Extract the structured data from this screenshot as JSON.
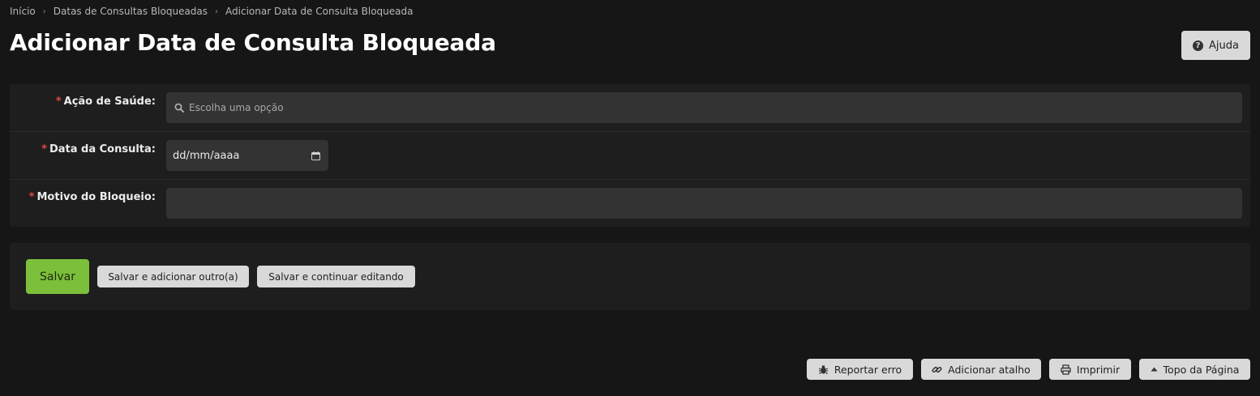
{
  "breadcrumb": {
    "items": [
      "Início",
      "Datas de Consultas Bloqueadas",
      "Adicionar Data de Consulta Bloqueada"
    ],
    "separator": "›"
  },
  "header": {
    "title": "Adicionar Data de Consulta Bloqueada",
    "help_label": "Ajuda",
    "help_icon": "question-circle-icon"
  },
  "form": {
    "required_marker": "*",
    "acao_saude": {
      "label": "Ação de Saúde:",
      "placeholder": "Escolha uma opção",
      "icon": "search-icon"
    },
    "data_consulta": {
      "label": "Data da Consulta:",
      "value": "dd/mm/aaaa",
      "icon": "calendar-icon"
    },
    "motivo_bloqueio": {
      "label": "Motivo do Bloqueio:",
      "value": ""
    }
  },
  "actions": {
    "save": "Salvar",
    "save_add_another": "Salvar e adicionar outro(a)",
    "save_continue": "Salvar e continuar editando"
  },
  "footer": {
    "report_error": "Reportar erro",
    "add_shortcut": "Adicionar atalho",
    "print": "Imprimir",
    "top_of_page": "Topo da Página"
  },
  "colors": {
    "background": "#161616",
    "panel": "#1e1e1e",
    "input": "#333333",
    "accent_green": "#7bbf3a",
    "required_red": "#e04848",
    "button_light": "#d9d9d9"
  }
}
